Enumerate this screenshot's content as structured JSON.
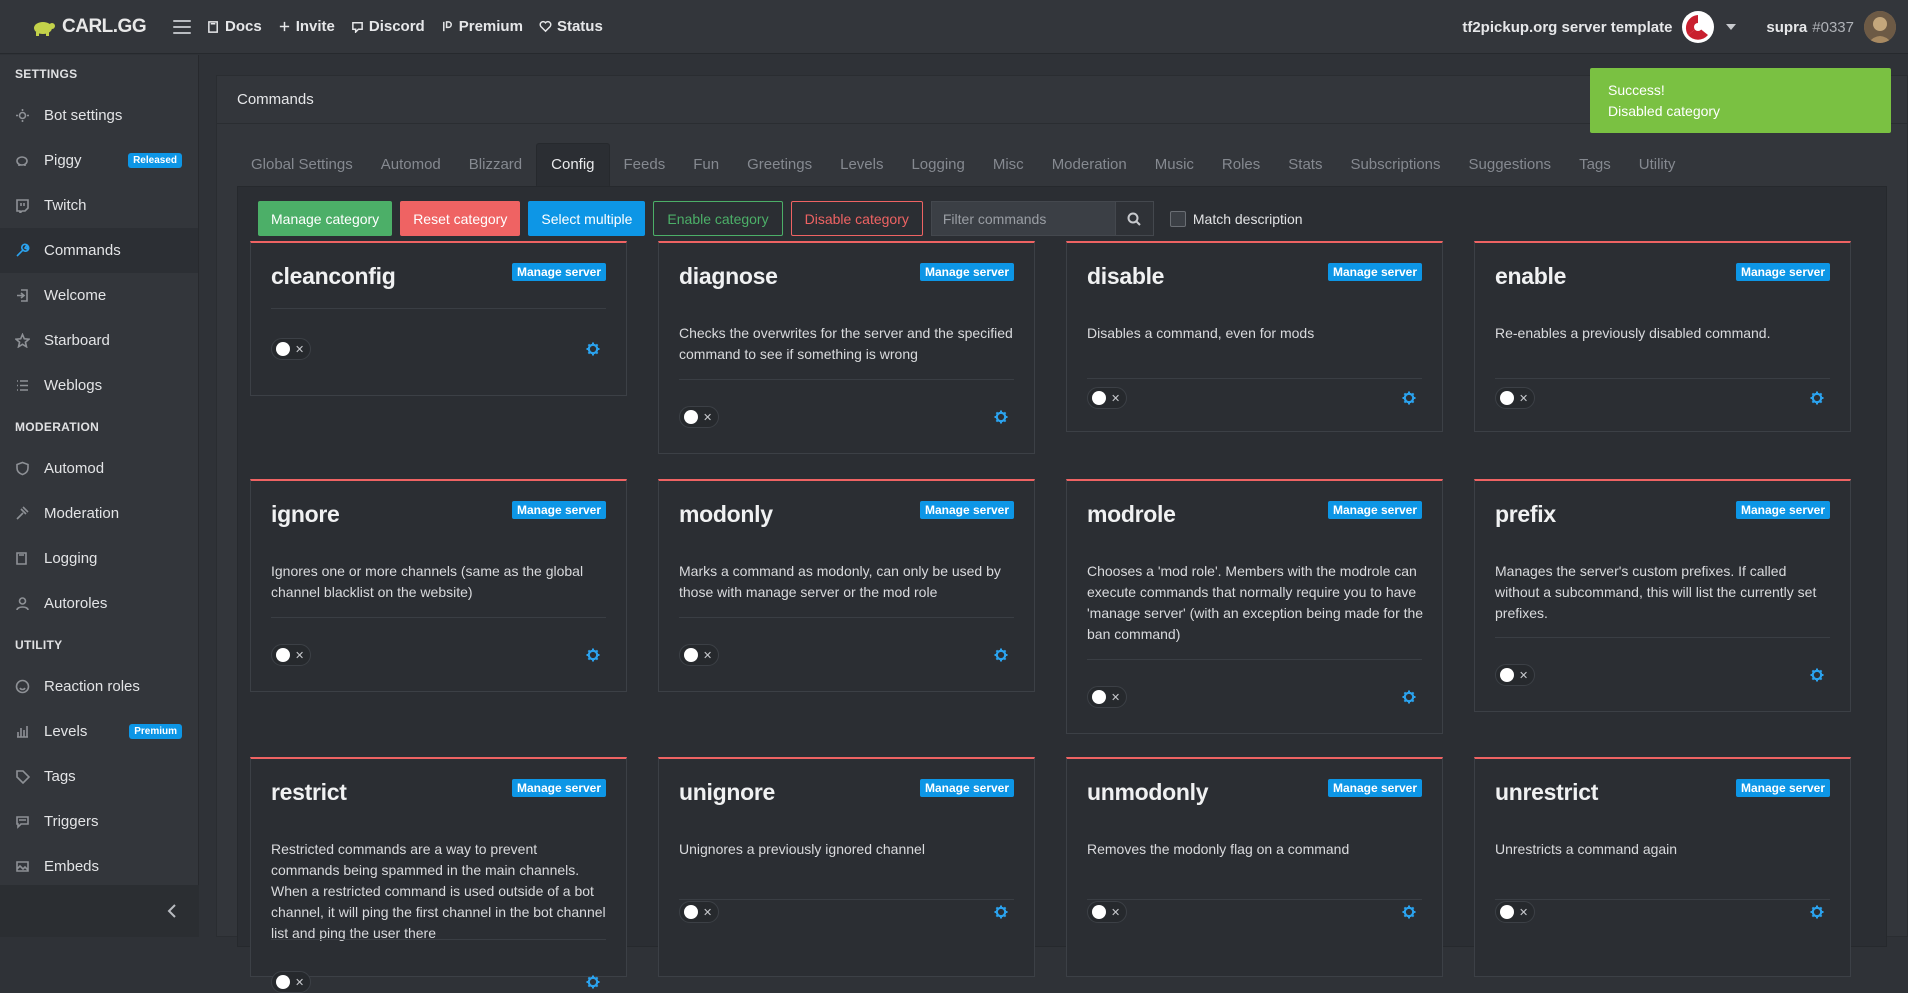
{
  "app": {
    "name": "CARL.GG"
  },
  "topnav": [
    {
      "label": "Docs",
      "icon": "book-icon"
    },
    {
      "label": "Invite",
      "icon": "plus-icon"
    },
    {
      "label": "Discord",
      "icon": "discord-icon"
    },
    {
      "label": "Premium",
      "icon": "patreon-icon"
    },
    {
      "label": "Status",
      "icon": "heart-icon"
    }
  ],
  "server": {
    "name": "tf2pickup.org server template"
  },
  "user": {
    "name": "supra",
    "discriminator": "#0337"
  },
  "sidebar": {
    "sections": [
      {
        "title": "SETTINGS",
        "items": [
          {
            "label": "Bot settings",
            "icon": "gear-icon"
          },
          {
            "label": "Piggy",
            "icon": "piggy-icon",
            "badge": "Released"
          },
          {
            "label": "Twitch",
            "icon": "twitch-icon"
          },
          {
            "label": "Commands",
            "icon": "wrench-icon",
            "active": true
          },
          {
            "label": "Welcome",
            "icon": "sign-in-icon"
          },
          {
            "label": "Starboard",
            "icon": "star-icon"
          },
          {
            "label": "Weblogs",
            "icon": "list-icon"
          }
        ]
      },
      {
        "title": "MODERATION",
        "items": [
          {
            "label": "Automod",
            "icon": "shield-icon"
          },
          {
            "label": "Moderation",
            "icon": "gavel-icon"
          },
          {
            "label": "Logging",
            "icon": "book-icon"
          },
          {
            "label": "Autoroles",
            "icon": "user-icon"
          }
        ]
      },
      {
        "title": "UTILITY",
        "items": [
          {
            "label": "Reaction roles",
            "icon": "smile-icon"
          },
          {
            "label": "Levels",
            "icon": "bar-chart-icon",
            "badge": "Premium"
          },
          {
            "label": "Tags",
            "icon": "tag-icon"
          },
          {
            "label": "Triggers",
            "icon": "message-icon"
          },
          {
            "label": "Embeds",
            "icon": "image-icon"
          }
        ]
      }
    ]
  },
  "panel": {
    "title": "Commands"
  },
  "tabs": [
    "Global Settings",
    "Automod",
    "Blizzard",
    "Config",
    "Feeds",
    "Fun",
    "Greetings",
    "Levels",
    "Logging",
    "Misc",
    "Moderation",
    "Music",
    "Roles",
    "Stats",
    "Subscriptions",
    "Suggestions",
    "Tags",
    "Utility"
  ],
  "active_tab": "Config",
  "toolbar": {
    "manage": "Manage category",
    "reset": "Reset category",
    "select_multiple": "Select multiple",
    "enable": "Enable category",
    "disable": "Disable category",
    "filter_placeholder": "Filter commands",
    "match_description": "Match description"
  },
  "toast": {
    "title": "Success!",
    "message": "Disabled category"
  },
  "commands": [
    {
      "name": "cleanconfig",
      "badge": "Manage server",
      "description": ""
    },
    {
      "name": "diagnose",
      "badge": "Manage server",
      "description": "Checks the overwrites for the server and the specified command to see if something is wrong"
    },
    {
      "name": "disable",
      "badge": "Manage server",
      "description": "Disables a command, even for mods"
    },
    {
      "name": "enable",
      "badge": "Manage server",
      "description": "Re-enables a previously disabled command."
    },
    {
      "name": "ignore",
      "badge": "Manage server",
      "description": "Ignores one or more channels (same as the global channel blacklist on the website)"
    },
    {
      "name": "modonly",
      "badge": "Manage server",
      "description": "Marks a command as modonly, can only be used by those with manage server or the mod role"
    },
    {
      "name": "modrole",
      "badge": "Manage server",
      "description": "Chooses a 'mod role'. Members with the modrole can execute commands that normally require you to have 'manage server' (with an exception being made for the ban command)"
    },
    {
      "name": "prefix",
      "badge": "Manage server",
      "description": "Manages the server's custom prefixes. If called without a subcommand, this will list the currently set prefixes."
    },
    {
      "name": "restrict",
      "badge": "Manage server",
      "description": "Restricted commands are a way to prevent commands being spammed in the main channels. When a restricted command is used outside of a bot channel, it will ping the first channel in the bot channel list and ping the user there"
    },
    {
      "name": "unignore",
      "badge": "Manage server",
      "description": "Unignores a previously ignored channel"
    },
    {
      "name": "unmodonly",
      "badge": "Manage server",
      "description": "Removes the modonly flag on a command"
    },
    {
      "name": "unrestrict",
      "badge": "Manage server",
      "description": "Unrestricts a command again"
    }
  ]
}
